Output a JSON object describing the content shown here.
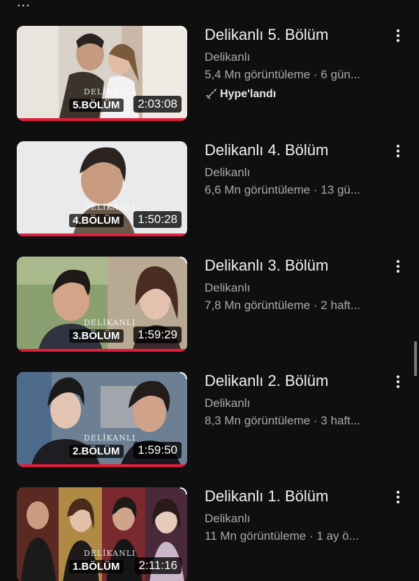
{
  "top_overflow_indicator": "...",
  "accent_color": "#e21e3c",
  "videos": [
    {
      "title": "Delikanlı 5. Bölüm",
      "channel": "Delikanlı",
      "stats": "5,4 Mn görüntüleme · 6 gün...",
      "badge": "Hype'landı",
      "badge_icon": "rocket-icon",
      "episode_label": "5.BÖLÜM",
      "logo_text": "DELİKANLI",
      "duration": "2:03:08"
    },
    {
      "title": "Delikanlı 4. Bölüm",
      "channel": "Delikanlı",
      "stats": "6,6 Mn görüntüleme · 13 gü...",
      "episode_label": "4.BÖLÜM",
      "logo_text": "DELİKANLI",
      "duration": "1:50:28"
    },
    {
      "title": "Delikanlı 3. Bölüm",
      "channel": "Delikanlı",
      "stats": "7,8 Mn görüntüleme · 2 haft...",
      "episode_label": "3.BÖLÜM",
      "logo_text": "DELİKANLI",
      "duration": "1:59:29"
    },
    {
      "title": "Delikanlı 2. Bölüm",
      "channel": "Delikanlı",
      "stats": "8,3 Mn görüntüleme · 3 haft...",
      "episode_label": "2.BÖLÜM",
      "logo_text": "DELİKANLI",
      "duration": "1:59:50"
    },
    {
      "title": "Delikanlı 1. Bölüm",
      "channel": "Delikanlı",
      "stats": "11 Mn görüntüleme · 1 ay ö...",
      "episode_label": "1.BÖLÜM",
      "logo_text": "DELİKANLI",
      "duration": "2:11:16"
    }
  ]
}
